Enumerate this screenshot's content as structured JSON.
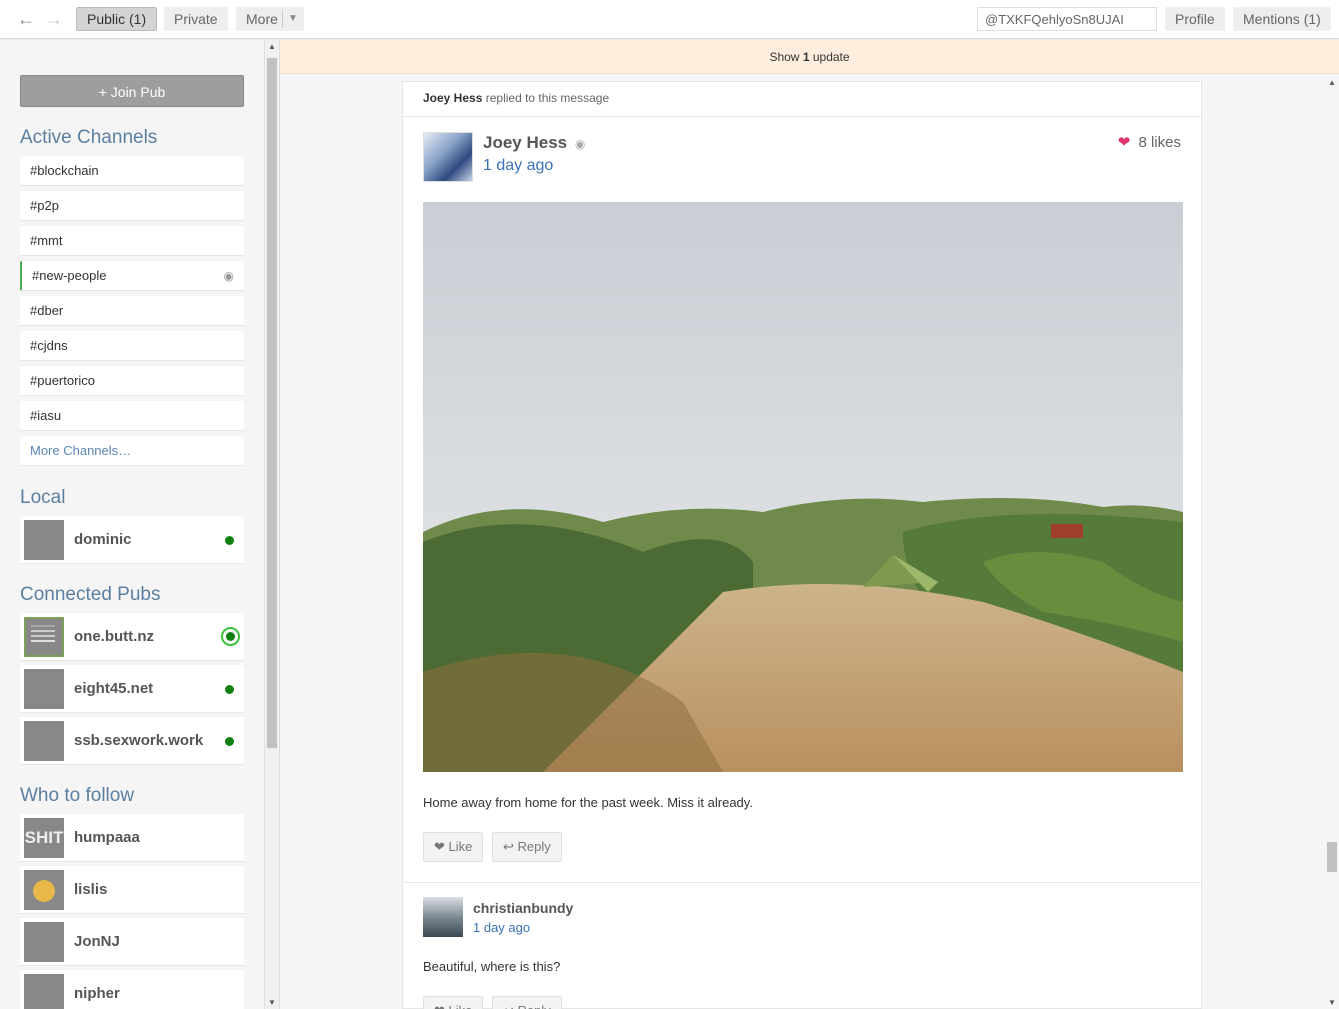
{
  "topbar": {
    "tabs": [
      {
        "label": "Public (1)"
      },
      {
        "label": "Private"
      },
      {
        "label": "More"
      }
    ],
    "search_value": "@TXKFQehlyoSn8UJAI",
    "profile_label": "Profile",
    "mentions_label": "Mentions (1)"
  },
  "sidebar": {
    "join_pub_label": "+ Join Pub",
    "active_channels_title": "Active Channels",
    "channels": [
      {
        "label": "#blockchain"
      },
      {
        "label": "#p2p"
      },
      {
        "label": "#mmt"
      },
      {
        "label": "#new-people",
        "subscribed": true
      },
      {
        "label": "#dber"
      },
      {
        "label": "#cjdns"
      },
      {
        "label": "#puertorico"
      },
      {
        "label": "#iasu"
      }
    ],
    "more_channels_label": "More Channels…",
    "local_title": "Local",
    "local_peers": [
      {
        "name": "dominic",
        "status": "online"
      }
    ],
    "connected_pubs_title": "Connected Pubs",
    "pubs": [
      {
        "name": "one.butt.nz",
        "status": "connected-active"
      },
      {
        "name": "eight45.net",
        "status": "online"
      },
      {
        "name": "ssb.sexwork.work",
        "status": "online"
      }
    ],
    "who_to_follow_title": "Who to follow",
    "suggestions": [
      {
        "name": "humpaaa",
        "avatar_text": "SHIT"
      },
      {
        "name": "lislis"
      },
      {
        "name": "JonNJ"
      },
      {
        "name": "nipher"
      }
    ]
  },
  "update_bar": {
    "prefix": "Show",
    "count": "1",
    "suffix": "update"
  },
  "thread": {
    "replied_note": {
      "author": "Joey Hess",
      "text": "replied to this message"
    },
    "post": {
      "author": "Joey Hess",
      "time": "1 day ago",
      "likes": "8 likes",
      "text": "Home away from home for the past week. Miss it already.",
      "like_label": "❤ Like",
      "reply_label": "↩ Reply"
    },
    "reply": {
      "author": "christianbundy",
      "time": "1 day ago",
      "text": "Beautiful, where is this?",
      "like_label": "❤ Like",
      "reply_label": "↩ Reply"
    }
  },
  "colors": {
    "accent_blue": "#3a72b5",
    "section_title": "#5b7fa0",
    "online_green": "#108010",
    "update_bar_bg": "#ffeedd",
    "heart_pink": "#e0336b"
  },
  "icons": {
    "back": "arrow-left-icon",
    "forward": "arrow-right-icon",
    "dropdown": "caret-down-icon",
    "subscribed": "radio-dot-icon",
    "heart": "heart-icon",
    "reply": "reply-arrow-icon"
  }
}
